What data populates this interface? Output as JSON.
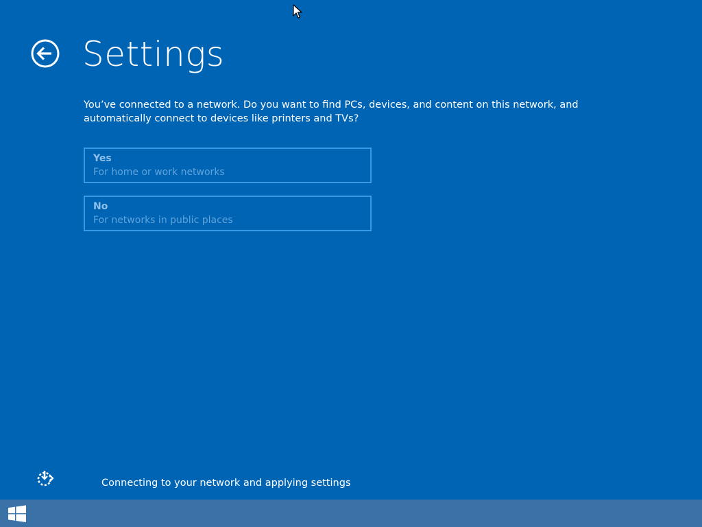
{
  "header": {
    "title": "Settings",
    "back_icon": "back-arrow-circle-icon"
  },
  "main": {
    "prompt": "You’ve connected to a network. Do you want to find PCs, devices, and content on this network, and automatically connect to devices like printers and TVs?",
    "options": [
      {
        "title": "Yes",
        "subtitle": "For home or work networks"
      },
      {
        "title": "No",
        "subtitle": "For networks in public places"
      }
    ]
  },
  "status": {
    "text": "Connecting to your network and applying settings",
    "icon": "network-activity-icon"
  },
  "taskbar": {
    "start_icon": "windows-logo-icon"
  },
  "colors": {
    "background": "#0064b4",
    "option_border": "#3a9ae6",
    "taskbar": "#3a72a8"
  }
}
